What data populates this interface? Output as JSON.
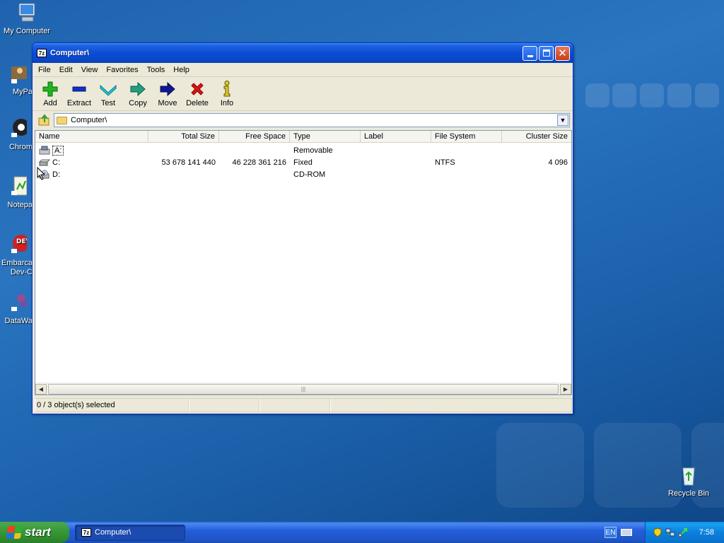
{
  "desktop": {
    "icons": [
      {
        "label": "My Computer"
      },
      {
        "label": "MyPa"
      },
      {
        "label": "Chrom"
      },
      {
        "label": "Notepa"
      },
      {
        "label": "Embarca\nDev-C"
      },
      {
        "label": "DataWa"
      },
      {
        "label": "Recycle Bin"
      }
    ]
  },
  "window": {
    "title": "Computer\\",
    "app_icon_text": "7z",
    "menu": [
      "File",
      "Edit",
      "View",
      "Favorites",
      "Tools",
      "Help"
    ],
    "toolbar": [
      {
        "label": "Add",
        "icon": "plus-icon",
        "color": "#22b422"
      },
      {
        "label": "Extract",
        "icon": "minus-icon",
        "color": "#1030c8"
      },
      {
        "label": "Test",
        "icon": "check-icon",
        "color": "#20b8c8"
      },
      {
        "label": "Copy",
        "icon": "arrow-right-icon",
        "color": "#20a080"
      },
      {
        "label": "Move",
        "icon": "arrow-right-icon",
        "color": "#101890"
      },
      {
        "label": "Delete",
        "icon": "x-icon",
        "color": "#e01010"
      },
      {
        "label": "Info",
        "icon": "info-icon",
        "color": "#d8c820"
      }
    ],
    "address": "Computer\\",
    "columns": [
      "Name",
      "Total Size",
      "Free Space",
      "Type",
      "Label",
      "File System",
      "Cluster Size"
    ],
    "rows": [
      {
        "name": "A:",
        "total": "",
        "free": "",
        "type": "Removable",
        "label": "",
        "fs": "",
        "cluster": ""
      },
      {
        "name": "C:",
        "total": "53 678 141 440",
        "free": "46 228 361 216",
        "type": "Fixed",
        "label": "",
        "fs": "NTFS",
        "cluster": "4 096"
      },
      {
        "name": "D:",
        "total": "",
        "free": "",
        "type": "CD-ROM",
        "label": "",
        "fs": "",
        "cluster": ""
      }
    ],
    "status": "0 / 3 object(s) selected"
  },
  "taskbar": {
    "start_label": "start",
    "task_title": "Computer\\",
    "lang": "EN",
    "clock": "7:58"
  }
}
